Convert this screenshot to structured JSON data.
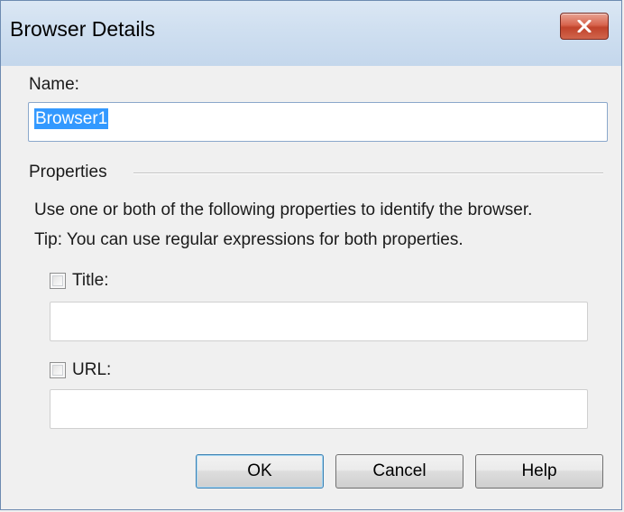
{
  "window": {
    "title": "Browser Details",
    "close_icon": "close-x-icon"
  },
  "name_field": {
    "label": "Name:",
    "value": "Browser1"
  },
  "properties": {
    "group_label": "Properties",
    "description_line1": "Use one or both of the following properties to identify the browser.",
    "description_line2": "Tip: You can use regular expressions for both properties.",
    "title_checkbox": {
      "label": "Title:",
      "checked": false,
      "value": ""
    },
    "url_checkbox": {
      "label": "URL:",
      "checked": false,
      "value": ""
    }
  },
  "buttons": {
    "ok": "OK",
    "cancel": "Cancel",
    "help": "Help"
  },
  "colors": {
    "selection": "#3399ff",
    "close_button": "#c7432b",
    "titlebar": "#cfdff0"
  }
}
